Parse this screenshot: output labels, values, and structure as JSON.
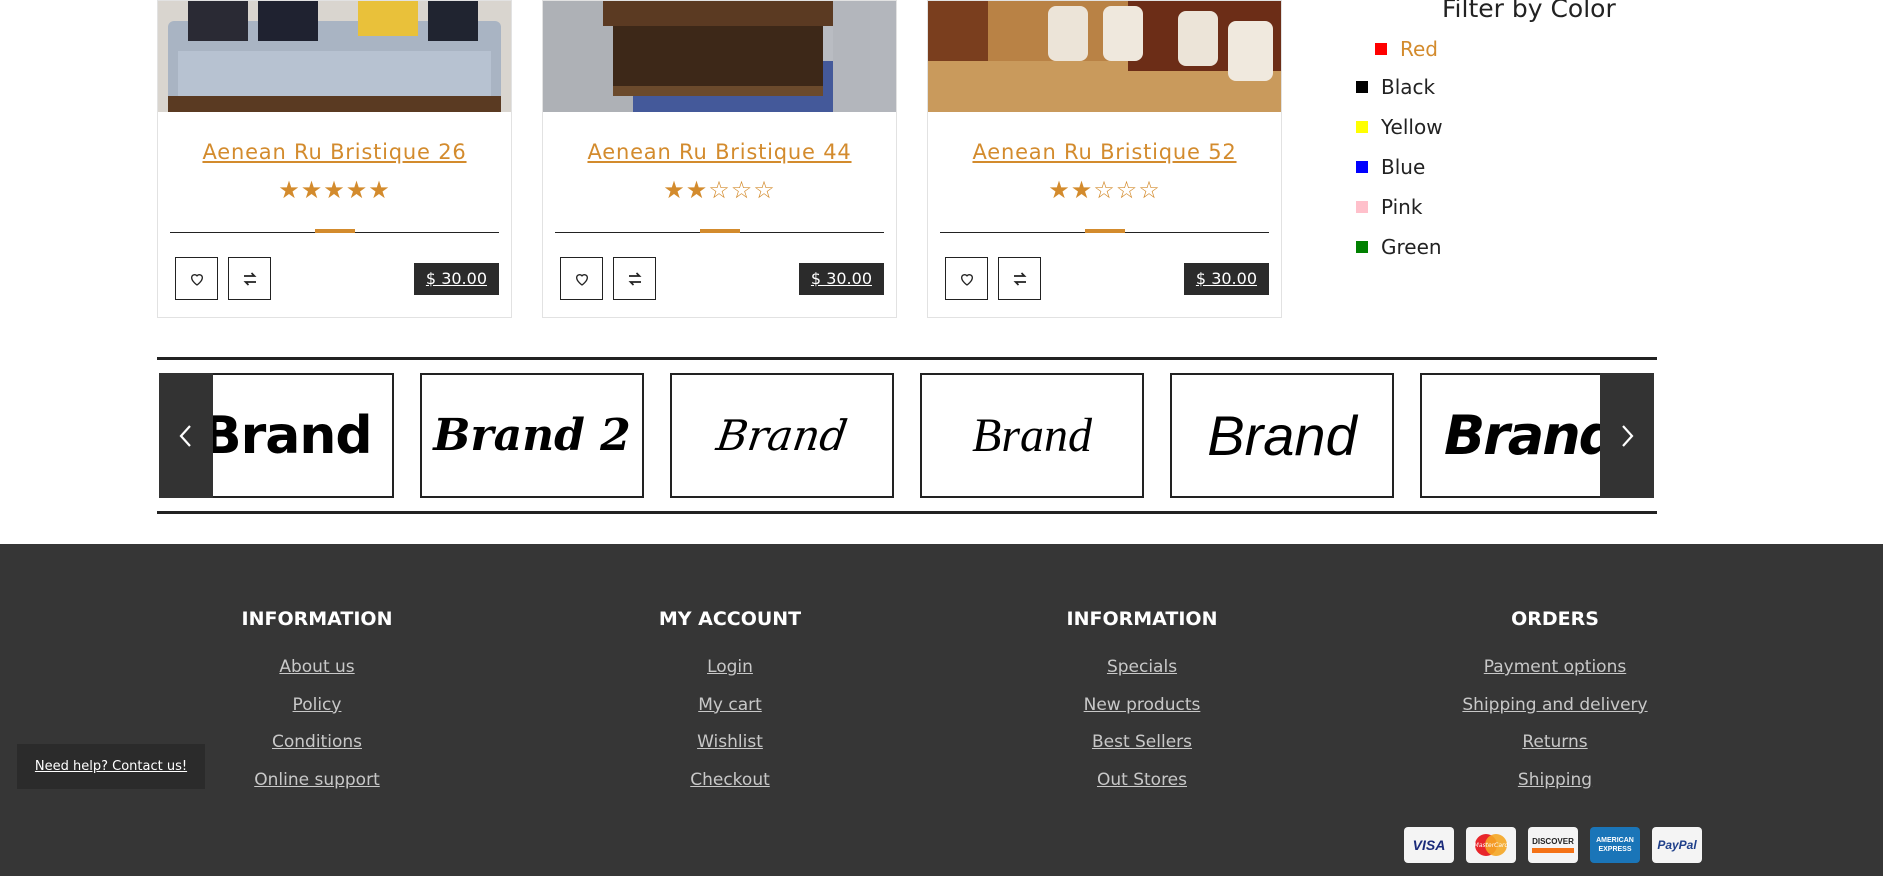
{
  "products": [
    {
      "title": "Aenean Ru Bristique 26",
      "rating": 5,
      "stars_text": "★★★★★",
      "price": "$ 30.00"
    },
    {
      "title": "Aenean Ru Bristique 44",
      "rating": 2,
      "stars_text": "★★☆☆☆",
      "price": "$ 30.00"
    },
    {
      "title": "Aenean Ru Bristique 52",
      "rating": 2,
      "stars_text": "★★☆☆☆",
      "price": "$ 30.00"
    }
  ],
  "filter": {
    "title": "Filter by Color",
    "colors": [
      {
        "label": "Red",
        "hex": "#ff0000",
        "active": true
      },
      {
        "label": "Black",
        "hex": "#000000",
        "active": false
      },
      {
        "label": "Yellow",
        "hex": "#ffff00",
        "active": false
      },
      {
        "label": "Blue",
        "hex": "#0000ff",
        "active": false
      },
      {
        "label": "Pink",
        "hex": "#ffc0cb",
        "active": false
      },
      {
        "label": "Green",
        "hex": "#008000",
        "active": false
      }
    ]
  },
  "brands": [
    "Brand",
    "Brand 2",
    "Brand",
    "Brand",
    "Brand",
    "Brand"
  ],
  "footer": {
    "columns": [
      {
        "heading": "INFORMATION",
        "links": [
          "About us",
          "Policy",
          "Conditions",
          "Online support"
        ]
      },
      {
        "heading": "MY ACCOUNT",
        "links": [
          "Login",
          "My cart",
          "Wishlist",
          "Checkout"
        ]
      },
      {
        "heading": "INFORMATION",
        "links": [
          "Specials",
          "New products",
          "Best Sellers",
          "Out Stores"
        ]
      },
      {
        "heading": "ORDERS",
        "links": [
          "Payment options",
          "Shipping and delivery",
          "Returns",
          "Shipping"
        ]
      }
    ],
    "help": "Need help? Contact us!",
    "payments": [
      "VISA",
      "MasterCard",
      "DISCOVER",
      "AMERICAN EXPRESS",
      "PayPal"
    ]
  },
  "colors": {
    "accent": "#d38b2d",
    "footer_bg": "#363636",
    "price_bg": "#2b2b2b"
  }
}
